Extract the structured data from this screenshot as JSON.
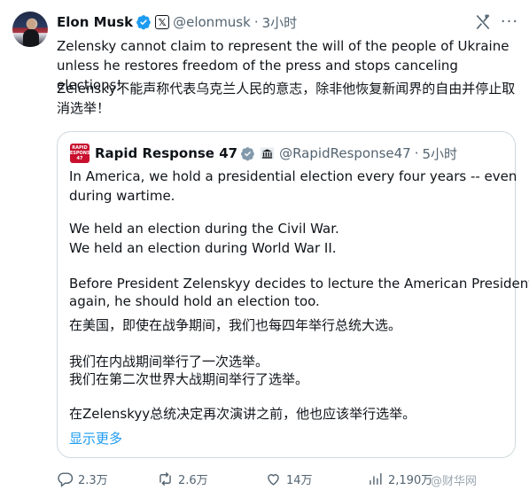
{
  "post": {
    "author_name": "Elon Musk",
    "author_handle": "@elonmusk",
    "time": "3小时",
    "text_en": "Zelensky cannot claim to represent the will of the people of Ukraine unless he restores freedom of the press and stops canceling elections!",
    "text_zh_line1": "Zelensky不能声称代表乌克兰人民的意志，除非他恢复新闻界的自由并停止取",
    "text_zh_line2": "消选举！"
  },
  "quote": {
    "author_name": "Rapid Response 47",
    "author_handle": "@RapidResponse47",
    "time": "5小时",
    "avatar_text": [
      "RAPID",
      "RESPONSE",
      "47"
    ],
    "lines": [
      "In America, we hold a presidential election every four years -- even",
      "during wartime.",
      "We held an election during the Civil War.",
      "We held an election during World War II.",
      "Before President Zelenskyy decides to lecture the American President",
      "again, he should hold an election too.",
      "在美国，即使在战争期间，我们也每四年举行总统大选。",
      "我们在内战期间举行了一次选举。",
      "我们在第二次世界大战期间举行了选举。",
      "在Zelenskyy总统决定再次演讲之前，他也应该举行选举。"
    ],
    "show_more": "显示更多"
  },
  "actions": {
    "replies": "2.3万",
    "reposts": "2.6万",
    "likes": "14万",
    "views": "2,190万"
  },
  "watermark": "@财华网",
  "colors": {
    "accent": "#1d9bf0",
    "muted": "#536471",
    "border": "#cfd9de",
    "brand_red": "#c8102e"
  }
}
